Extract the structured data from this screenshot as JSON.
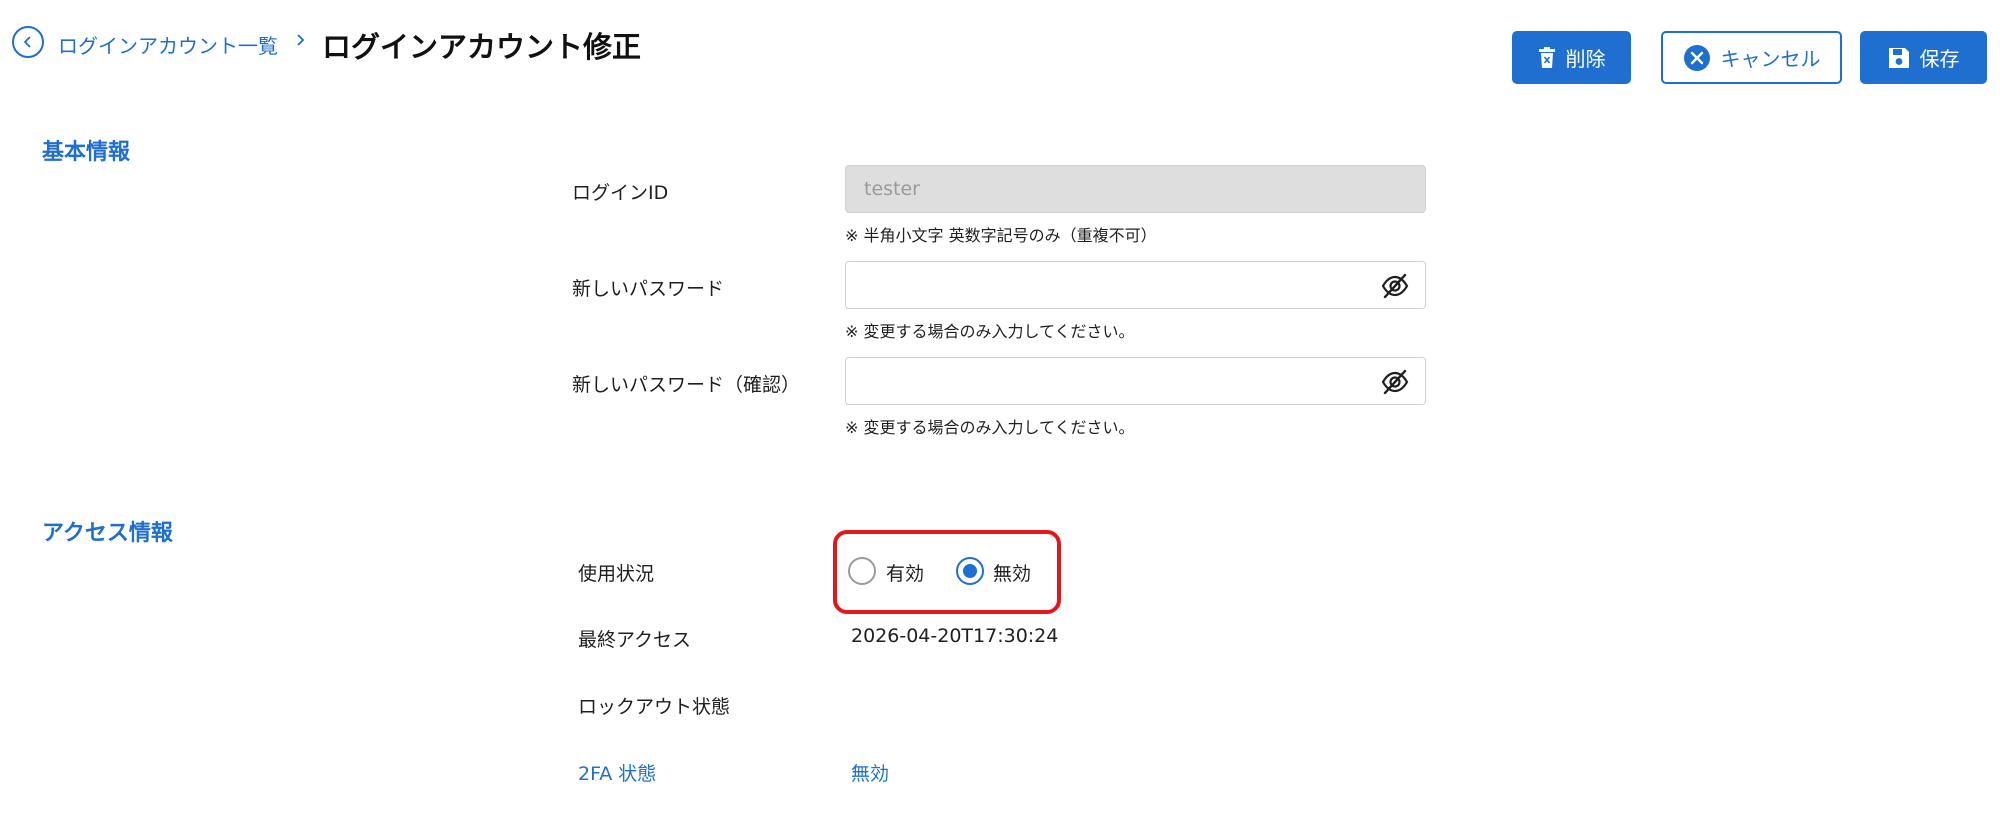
{
  "header": {
    "breadcrumb_parent": "ログインアカウント一覧",
    "title": "ログインアカウント修正",
    "buttons": {
      "delete": "削除",
      "cancel": "キャンセル",
      "save": "保存"
    }
  },
  "basic_info": {
    "section_title": "基本情報",
    "login_id": {
      "label": "ログインID",
      "value": "tester",
      "hint": "※ 半角小文字 英数字記号のみ（重複不可）"
    },
    "new_password": {
      "label": "新しいパスワード",
      "value": "",
      "hint": "※ 変更する場合のみ入力してください。"
    },
    "confirm_password": {
      "label": "新しいパスワード（確認）",
      "value": "",
      "hint": "※ 変更する場合のみ入力してください。"
    }
  },
  "access_info": {
    "section_title": "アクセス情報",
    "usage_status": {
      "label": "使用状況",
      "options": [
        "有効",
        "無効"
      ],
      "selected": "無効"
    },
    "last_access": {
      "label": "最終アクセス",
      "value": "2026-04-20T17:30:24"
    },
    "lockout_status": {
      "label": "ロックアウト状態",
      "value": ""
    },
    "twofa_status": {
      "label": "2FA 状態",
      "value": "無効"
    }
  },
  "colors": {
    "accent": "#1f6fd0",
    "highlight_frame": "#e8141d",
    "disabled_input": "#dedede"
  },
  "icons": {
    "back": "chevron-left-circle-icon",
    "crumb_separator": "chevron-right-icon",
    "delete": "trash-icon",
    "cancel": "x-circle-icon",
    "save": "floppy-disk-icon",
    "password_toggle": "eye-slash-icon"
  }
}
